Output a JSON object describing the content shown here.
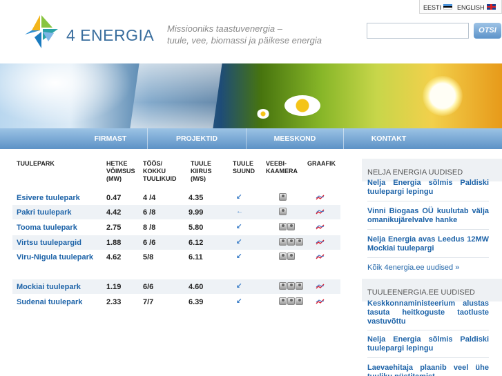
{
  "header": {
    "logo_text": "4 ENERGIA",
    "slogan_line1": "Missiooniks taastuvenergia –",
    "slogan_line2": "tuule, vee, biomassi ja päikese energia",
    "lang_et": "EESTI",
    "lang_en": "ENGLISH",
    "search_placeholder": "",
    "search_button": "OTSI"
  },
  "nav": {
    "items": [
      "FIRMAST",
      "PROJEKTID",
      "MEESKOND",
      "KONTAKT"
    ]
  },
  "table": {
    "headers": {
      "park": "TUULEPARK",
      "power_l1": "HETKE",
      "power_l2": "VÕIMSUS",
      "power_l3": "(MW)",
      "turbines_l1": "TÖÖS/",
      "turbines_l2": "KOKKU",
      "turbines_l3": "TUULIKUID",
      "speed_l1": "TUULE",
      "speed_l2": "KIIRUS",
      "speed_l3": "(M/S)",
      "dir_l1": "TUULE",
      "dir_l2": "SUUND",
      "cam_l1": "VEEBI-",
      "cam_l2": "KAAMERA",
      "graph": "GRAAFIK"
    },
    "rows": [
      {
        "park": "Esivere tuulepark",
        "power": "0.47",
        "turbines": "4 /4",
        "speed": "4.35",
        "dir_icon": "arrow-southwest-icon",
        "cams": 1
      },
      {
        "park": "Pakri tuulepark",
        "power": "4.42",
        "turbines": "6 /8",
        "speed": "9.99",
        "dir_icon": "arrow-west-icon",
        "cams": 1
      },
      {
        "park": "Tooma tuulepark",
        "power": "2.75",
        "turbines": "8 /8",
        "speed": "5.80",
        "dir_icon": "arrow-southwest-icon",
        "cams": 2
      },
      {
        "park": "Virtsu tuulepargid",
        "power": "1.88",
        "turbines": "6 /6",
        "speed": "6.12",
        "dir_icon": "arrow-southwest-icon",
        "cams": 3
      },
      {
        "park": "Viru-Nigula tuulepark",
        "power": "4.62",
        "turbines": "5/8",
        "speed": "6.11",
        "dir_icon": "arrow-southwest-icon",
        "cams": 2
      },
      {
        "park": "Mockiai tuulepark",
        "power": "1.19",
        "turbines": "6/6",
        "speed": "4.60",
        "dir_icon": "arrow-southwest-icon",
        "cams": 3
      },
      {
        "park": "Sudenai tuulepark",
        "power": "2.33",
        "turbines": "7/7",
        "speed": "6.39",
        "dir_icon": "arrow-southwest-icon",
        "cams": 3
      }
    ]
  },
  "sidebar": {
    "news1_title": "NELJA ENERGIA UUDISED",
    "news1": [
      "Nelja Energia sõlmis Paldiski tuulepargi lepingu",
      "Vinni Biogaas OÜ kuulutab välja omanikujärelvalve hanke",
      "Nelja Energia avas Leedus 12MW Mockiai tuulepargi"
    ],
    "news1_more": "Kõik 4energia.ee uudised »",
    "news2_title": "TUULEENERGIA.EE UUDISED",
    "news2": [
      "Keskkonnaministeerium alustas tasuta heitkoguste taotluste vastuvõttu",
      "Nelja Energia sõlmis Paldiski tuulepargi lepingu",
      "Laevaehitaja plaanib veel ühe tuuliku püstitamist"
    ]
  },
  "colors": {
    "nav_top": "#9cc3e5",
    "nav_bottom": "#5d92c6",
    "link": "#1d63a8",
    "row_alt": "#eef2f6"
  }
}
